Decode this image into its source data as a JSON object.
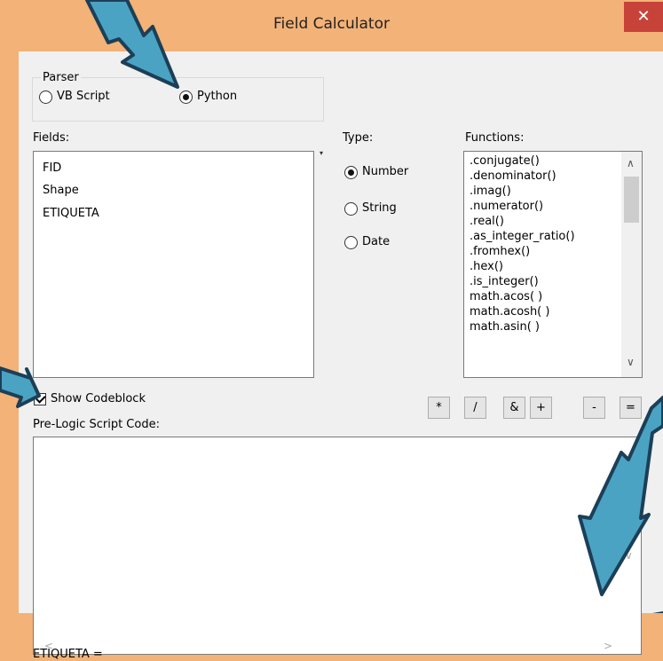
{
  "window": {
    "title": "Field Calculator",
    "close_glyph": "✕"
  },
  "parser": {
    "legend": "Parser",
    "vb_label": "VB Script",
    "python_label": "Python",
    "selected": "Python"
  },
  "fields": {
    "label": "Fields:",
    "items": [
      "FID",
      "Shape",
      "ETIQUETA"
    ]
  },
  "type": {
    "label": "Type:",
    "number_label": "Number",
    "string_label": "String",
    "date_label": "Date",
    "selected": "Number"
  },
  "functions": {
    "label": "Functions:",
    "items": [
      ".conjugate()",
      ".denominator()",
      ".imag()",
      ".numerator()",
      ".real()",
      ".as_integer_ratio()",
      ".fromhex()",
      ".hex()",
      ".is_integer()",
      "math.acos( )",
      "math.acosh( )",
      "math.asin( )"
    ]
  },
  "operators": [
    "*",
    "/",
    "&",
    "+",
    "-",
    "="
  ],
  "codeblock": {
    "show_label": "Show Codeblock",
    "checked": true,
    "prelogic_label": "Pre-Logic Script Code:",
    "code": ""
  },
  "expression": {
    "label": "ETIQUETA ="
  },
  "colors": {
    "titlebar": "#f3b277",
    "close_button": "#c7433a",
    "annotation_arrow": "#4ba3c3"
  },
  "icons": {
    "close": "close-icon",
    "arrow": "arrow-annotation"
  }
}
